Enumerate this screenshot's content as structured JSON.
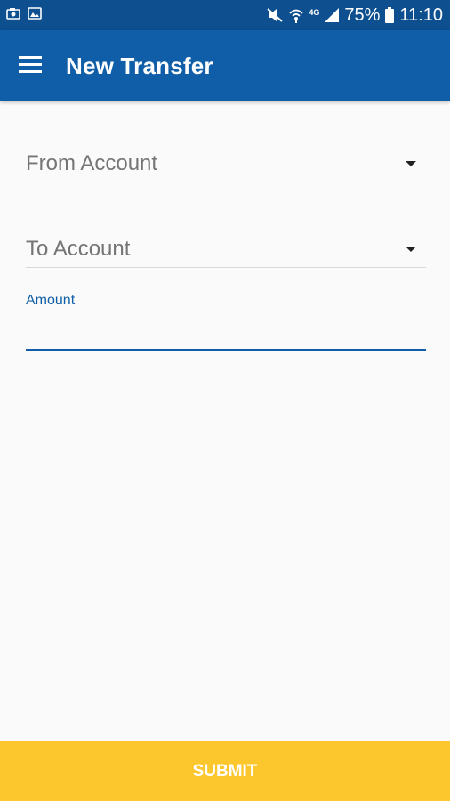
{
  "status_bar": {
    "battery": "75%",
    "time": "11:10",
    "network_label": "4G",
    "icons": {
      "left": [
        "screenshot-icon",
        "image-icon"
      ],
      "right": [
        "mute-icon",
        "wifi-icon",
        "lte-icon",
        "signal-icon",
        "battery-icon"
      ]
    }
  },
  "app_bar": {
    "title": "New Transfer",
    "menu_icon": "hamburger-menu-icon"
  },
  "form": {
    "from_account": {
      "label": "From Account"
    },
    "to_account": {
      "label": "To Account"
    },
    "amount": {
      "label": "Amount",
      "value": ""
    }
  },
  "submit_label": "SUBMIT",
  "colors": {
    "status_bar": "#0d4f8f",
    "app_bar": "#0f5ea7",
    "accent": "#0f5ea7",
    "submit": "#fcc62d",
    "background": "#fafafa"
  }
}
